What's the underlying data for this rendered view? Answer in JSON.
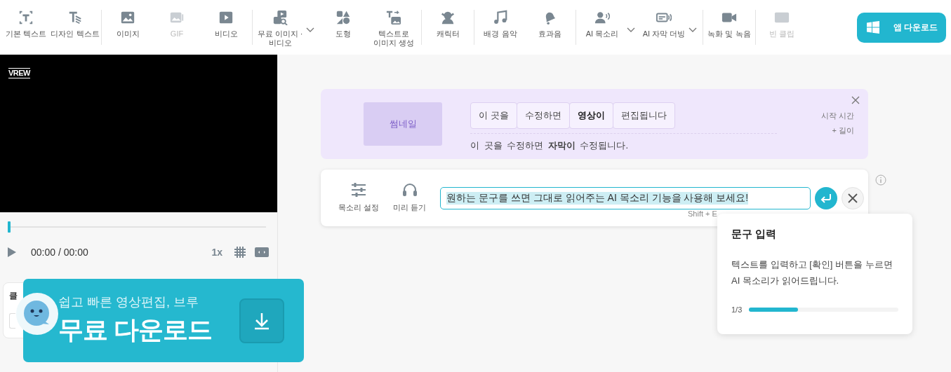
{
  "toolbar": {
    "groups": [
      {
        "items": [
          {
            "label": "기본 텍스트",
            "disabled": false,
            "dropdown": false
          },
          {
            "label": "디자인 텍스트",
            "disabled": false,
            "dropdown": false
          }
        ]
      },
      {
        "items": [
          {
            "label": "이미지",
            "disabled": false,
            "dropdown": false
          },
          {
            "label": "GIF",
            "disabled": true,
            "dropdown": false
          },
          {
            "label": "비디오",
            "disabled": false,
            "dropdown": false
          }
        ]
      },
      {
        "items": [
          {
            "label": "무료 이미지 · 비디오",
            "disabled": false,
            "dropdown": true
          },
          {
            "label": "도형",
            "disabled": false,
            "dropdown": false
          },
          {
            "label": "텍스트로 이미지 생성",
            "disabled": false,
            "dropdown": false
          }
        ]
      },
      {
        "items": [
          {
            "label": "캐릭터",
            "disabled": false,
            "dropdown": false
          }
        ]
      },
      {
        "items": [
          {
            "label": "배경 음악",
            "disabled": false,
            "dropdown": false
          },
          {
            "label": "효과음",
            "disabled": false,
            "dropdown": false
          }
        ]
      },
      {
        "items": [
          {
            "label": "AI 목소리",
            "disabled": false,
            "dropdown": true
          },
          {
            "label": "AI 자막 더빙",
            "disabled": false,
            "dropdown": true
          }
        ]
      },
      {
        "items": [
          {
            "label": "녹화 및 녹음",
            "disabled": false,
            "dropdown": false
          }
        ]
      },
      {
        "items": [
          {
            "label": "빈 클립",
            "disabled": true,
            "dropdown": false
          }
        ]
      }
    ],
    "download_button": "앱 다운로드"
  },
  "player": {
    "logo": "VREW",
    "level": 0,
    "time": "00:00 / 00:00",
    "speed": "1x"
  },
  "clip_panel": {
    "title": "클"
  },
  "banner": {
    "subtitle": "쉽고 빠른 영상편집, 브루",
    "title": "무료 다운로드"
  },
  "clip_editor": {
    "thumbnail": "썸네일",
    "words": [
      {
        "text": "이 곳을",
        "bold": false
      },
      {
        "text": "수정하면",
        "bold": false
      },
      {
        "text": "영상이",
        "bold": true
      },
      {
        "text": "편집됩니다",
        "bold": false
      }
    ],
    "subtitle": "이 곳을 수정하면 **자막이** 수정됩니다.",
    "timing": [
      "시작 시간",
      "+ 길이"
    ]
  },
  "voice_input": {
    "tools": [
      "목소리 설정",
      "미리 듣기"
    ],
    "value": "원하는 문구를 쓰면 그대로 읽어주는 AI 목소리 기능을 사용해 보세요!",
    "hint": "Shift + E"
  },
  "tooltip": {
    "title": "문구 입력",
    "body": "텍스트를 입력하고 [확인] 버튼을 누르면 AI 목소리가 읽어드립니다.",
    "step": "1/3",
    "level": 0.33
  }
}
